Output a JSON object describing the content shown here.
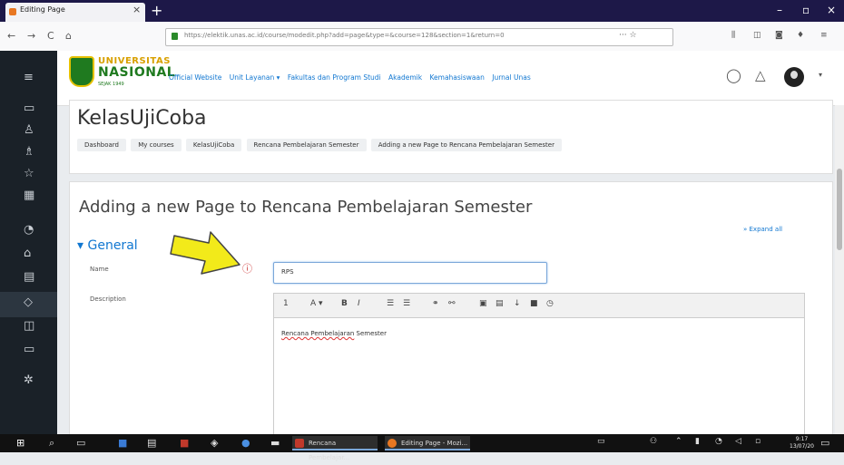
{
  "browser": {
    "tab_title": "Editing Page",
    "tab_close": "×",
    "new_tab": "+",
    "url": "https://elektik.unas.ac.id/course/modedit.php?add=page&type=&course=128&section=1&return=0",
    "nav_back": "←",
    "nav_forward": "→",
    "nav_reload": "C",
    "nav_home": "⌂",
    "url_actions": "··· ☆",
    "window_controls": [
      "–",
      "▫",
      "×"
    ]
  },
  "header": {
    "logo_line1": "UNIVERSITAS",
    "logo_line2": "NASIONAL",
    "logo_line3": "SEJAK 1949",
    "menu": [
      "Official Website",
      "Unit Layanan ▾",
      "Fakultas dan Program Studi",
      "Akademik",
      "Kemahasiswaan",
      "Jurnal Unas"
    ],
    "message_icon": "◯",
    "notification_icon": "△",
    "user_menu_caret": "▾"
  },
  "sidebar": {
    "icons": [
      "≡",
      "▭",
      "♙",
      "♗",
      "☆",
      "▦",
      "◔",
      "⌂",
      "▤",
      "◇",
      "◫",
      "▭",
      "✲"
    ]
  },
  "course": {
    "title": "KelasUjiCoba",
    "breadcrumbs": [
      "Dashboard",
      "My courses",
      "KelasUjiCoba",
      "Rencana Pembelajaran Semester",
      "Adding a new Page to Rencana Pembelajaran Semester"
    ]
  },
  "form": {
    "heading": "Adding a new Page to Rencana Pembelajaran Semester",
    "expand_all": "» Expand all",
    "section_title": "General",
    "section_toggle": "▾",
    "name_label": "Name",
    "name_value": "RPS",
    "required_icon": "ⓘ",
    "description_label": "Description",
    "editor_toolbar": [
      "1",
      "A ▾",
      "B",
      "I",
      "☰",
      "☰",
      "⚭",
      "⚯",
      "▣",
      "▤",
      "↓",
      "■",
      "◷"
    ],
    "editor_text_spell": "Rencana Pembelajaran",
    "editor_text_rest": " Semester"
  },
  "taskbar": {
    "apps": [
      "Rencana Pembelajar...",
      "Editing Page - Mozi..."
    ],
    "clock_time": "9:17",
    "clock_date": "13/07/20",
    "accent": "#7aa7d9"
  },
  "colors": {
    "sidebar_bg": "#1a2128",
    "link": "#1177d1",
    "browser_tab_bar": "#1d1848",
    "arrow_fill": "#f2ea1a"
  }
}
